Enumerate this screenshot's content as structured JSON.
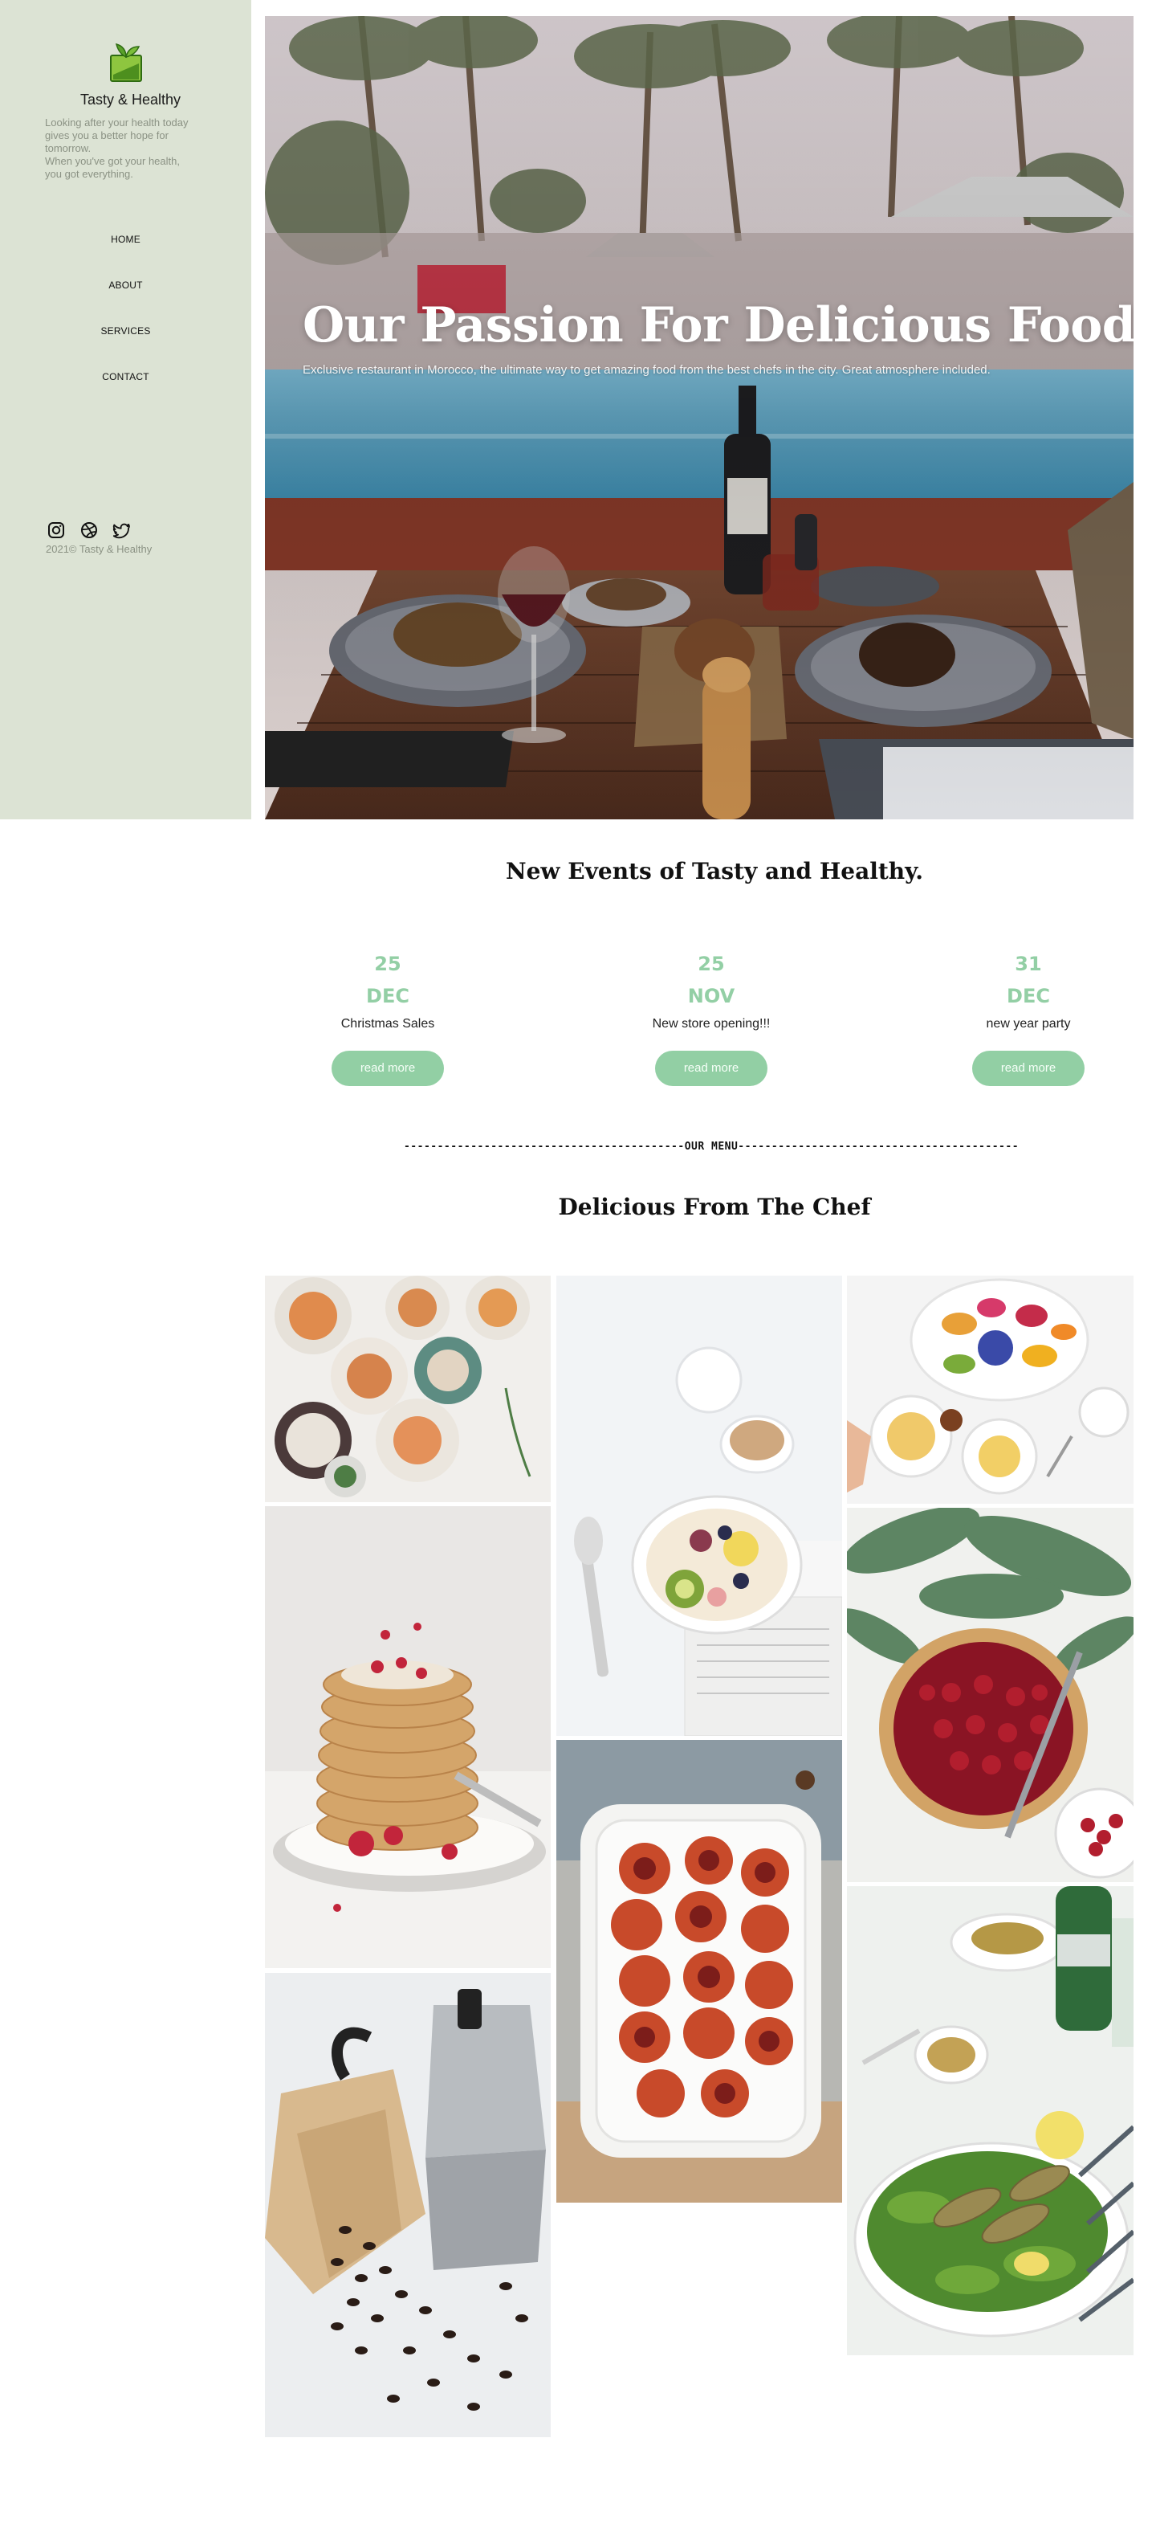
{
  "brand": {
    "name": "Tasty & Healthy",
    "tagline_lines": [
      "Looking after your health today",
      "gives you a better hope for",
      "tomorrow.",
      "When you've got your health,",
      "you got everything."
    ],
    "logo_icon": "leaf-logo-icon",
    "accent": "#92cfa4",
    "sidebar_bg": "#dce3d4"
  },
  "nav": [
    "HOME",
    "ABOUT",
    "SERVICES",
    "CONTACT"
  ],
  "socials": [
    "instagram-icon",
    "dribbble-icon",
    "twitter-icon"
  ],
  "copyright": "2021© Tasty & Healthy",
  "hero": {
    "title": "Our Passion For Delicious Food.",
    "subtitle": "Exclusive restaurant in Morocco, the ultimate way to get amazing food from the best chefs in the city. Great atmosphere included."
  },
  "events": {
    "title": "New Events of Tasty and Healthy.",
    "items": [
      {
        "day": "25",
        "month": "DEC",
        "name": "Christmas Sales",
        "button": "read more"
      },
      {
        "day": "25",
        "month": "NOV",
        "name": "New store opening!!!",
        "button": "read more"
      },
      {
        "day": "31",
        "month": "DEC",
        "name": "new year party",
        "button": "read more"
      }
    ]
  },
  "menu": {
    "divider": "------------------------------------------OUR MENU------------------------------------------",
    "title": "Delicious From The Chef"
  }
}
